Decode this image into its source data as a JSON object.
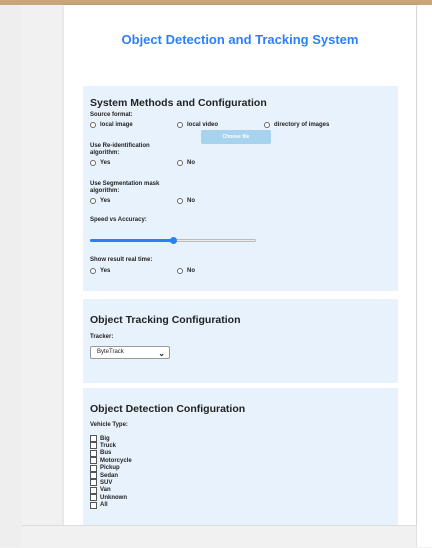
{
  "title": "Object Detection and Tracking System",
  "system": {
    "heading": "System Methods and Configuration",
    "source_label": "Source format:",
    "source_options": [
      "local image",
      "local video",
      "directory of images"
    ],
    "choose_file": "Choose file",
    "reid_label_1": "Use Re-identification",
    "reid_label_2": "algorithm:",
    "seg_label_1": "Use Segmentation mask",
    "seg_label_2": "algorithm:",
    "yes": "Yes",
    "no": "No",
    "speed_label": "Speed vs Accuracy:",
    "speed_value": 0.5,
    "realtime_label": "Show result real time:"
  },
  "tracking": {
    "heading": "Object Tracking Configuration",
    "tracker_label": "Tracker:",
    "tracker_value": "ByteTrack"
  },
  "detection": {
    "heading": "Object Detection Configuration",
    "vehicle_label": "Vehicle Type:",
    "vehicles": [
      "Big",
      "Truck",
      "Bus",
      "Motorcycle",
      "Pickup",
      "Sedan",
      "SUV",
      "Van",
      "Unknown",
      "All"
    ]
  },
  "colors": {
    "accent": "#2d7ff9",
    "card_bg": "#e8f2fd",
    "button_bg": "#a7d3ee"
  }
}
